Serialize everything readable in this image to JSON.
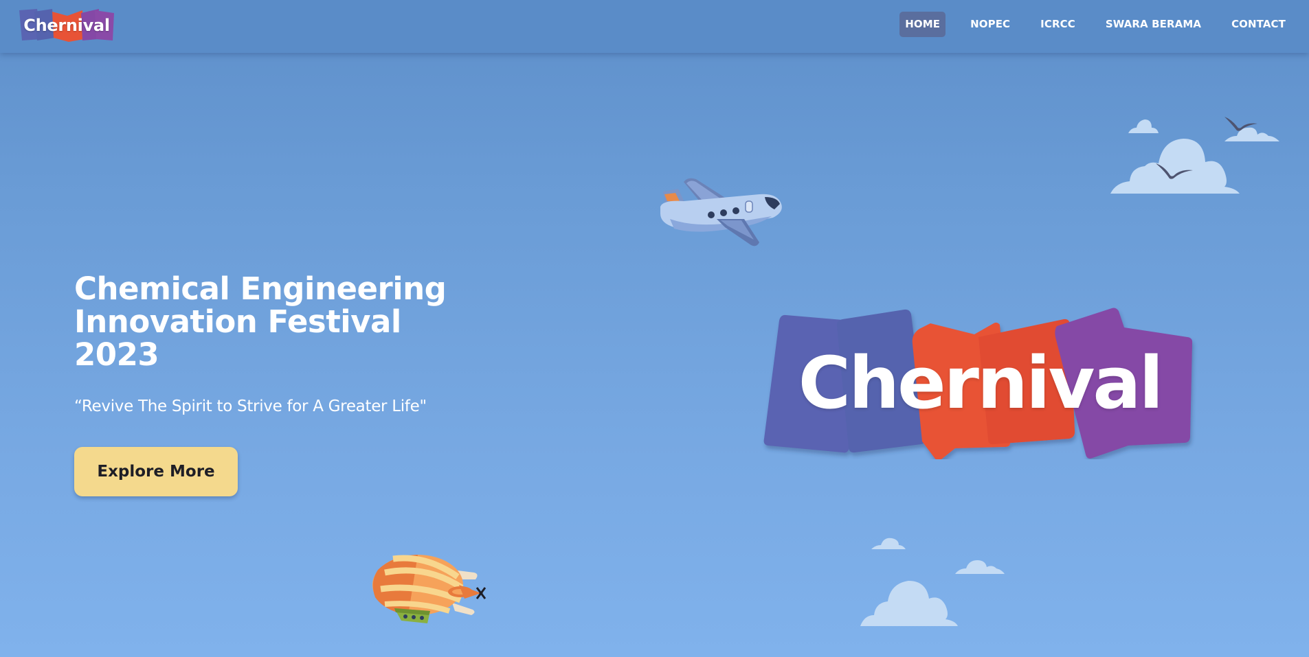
{
  "brand": {
    "name": "Chernival",
    "colors": {
      "blue": "#5a64b2",
      "orange": "#e85336",
      "purple": "#8548a6"
    }
  },
  "nav": {
    "items": [
      {
        "label": "HOME",
        "active": true
      },
      {
        "label": "NOPEC",
        "active": false
      },
      {
        "label": "ICRCC",
        "active": false
      },
      {
        "label": "SWARA BERAMA",
        "active": false
      },
      {
        "label": "CONTACT",
        "active": false
      }
    ]
  },
  "hero": {
    "title": "Chemical Engineering Innovation Festival 2023",
    "tagline": "“Revive The Spirit to Strive for A Greater Life\"",
    "cta_label": "Explore More"
  },
  "decorations": [
    "airplane-icon",
    "blimp-icon",
    "cloud-icon",
    "bird-icon"
  ],
  "theme": {
    "background": "#6a9cd6",
    "button": "#f4d98d",
    "nav_active": "#5a6e9e"
  }
}
